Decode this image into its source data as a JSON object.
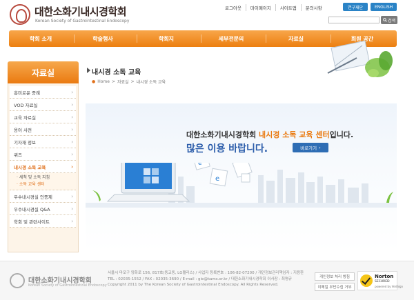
{
  "header": {
    "logo_title": "대한소화기내시경학회",
    "logo_subtitle": "Korean Society of Gastrointestinal Endoscopy",
    "links": [
      "로그아웃",
      "마이페이지",
      "사이트맵",
      "문의사항"
    ],
    "btn_report": "연구재단",
    "btn_english": "ENGLISH",
    "search_placeholder": "",
    "search_label": "검색"
  },
  "nav": [
    "학회 소개",
    "학술행사",
    "학회지",
    "세부전문의",
    "자료실",
    "회원 공간"
  ],
  "sidebar": {
    "title": "자료실",
    "items": [
      {
        "label": "흥미로운 증례"
      },
      {
        "label": "VOD 자료실"
      },
      {
        "label": "교육 자료실"
      },
      {
        "label": "용어 사전"
      },
      {
        "label": "기자재 정보"
      },
      {
        "label": "퀴즈"
      },
      {
        "label": "내시경 소독 교육"
      }
    ],
    "sub_items": [
      "· 세척 및 소독 지침",
      "· 소독 교육 센터"
    ],
    "items_after": [
      {
        "label": "우수내시경실 인증제"
      },
      {
        "label": "우수내시경실 Q&A"
      },
      {
        "label": "학회 및 관련사이트"
      }
    ]
  },
  "content": {
    "title": "내시경 소독 교육",
    "breadcrumb": [
      "Home",
      ">",
      "자료실",
      ">",
      "내시경 소독 교육"
    ],
    "banner_prefix": "대한소화기내시경학회 ",
    "banner_highlight": "내시경 소독 교육 센터",
    "banner_suffix": "입니다.",
    "banner_line2": "많은 이용 바랍니다.",
    "go_button": "바로가기"
  },
  "footer": {
    "logo_title": "대한소화기내시경학회",
    "logo_subtitle": "Korean Society of Gastrointestinal Endoscopy",
    "line1": "서울시 마포구 양화로 156, 817호(동교동, LG팰리스) / 사업자 등록번호 : 106-82-07200 / 개인정보관리책임자 : 지용환",
    "line2": "TEL : 02035-1552 / FAX : 02035-3690 / E-mail : gie@kams.or.kr / 대한소화기내시경학회 이사장 : 최명규",
    "line3": "Copyright 2011 by The Korean Society of Gastrointestinal Endoscopy. All Rights Reserved.",
    "btn_privacy": "개인정보 처리 방침",
    "btn_email": "이메일 무단수집 거부",
    "norton_name": "Norton",
    "norton_secured": "SECURED",
    "norton_by": "powered by VeriSign"
  },
  "colors": {
    "accent_orange": "#ea7a10",
    "accent_blue": "#2e6db4"
  }
}
